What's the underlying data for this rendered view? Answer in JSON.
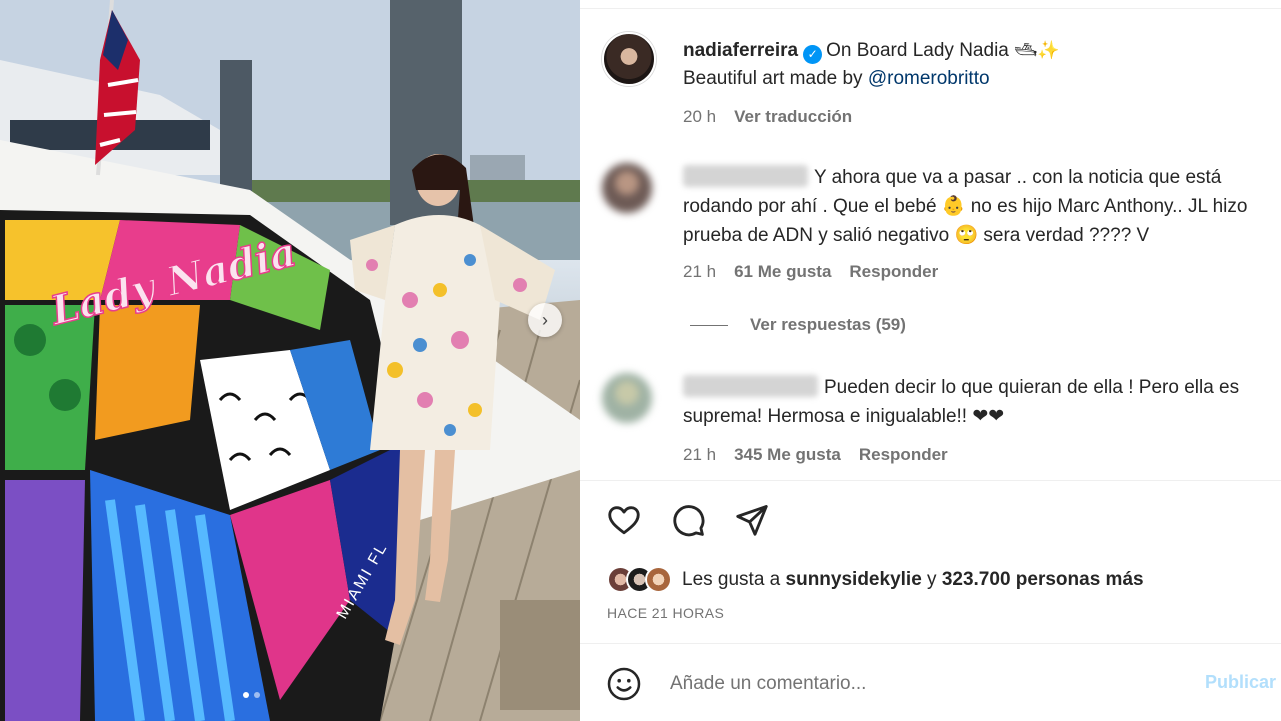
{
  "post": {
    "username": "nadiaferreira",
    "caption_title": "On Board Lady Nadia",
    "caption_emojis": "🛥✨",
    "caption_line2_prefix": "Beautiful art made by",
    "mention": "@romerobritto",
    "time": "20 h",
    "translate_label": "Ver traducción",
    "photo_text": {
      "boat_name": "Lady Nadia",
      "hull_text": "MIAMI FL"
    }
  },
  "comments": [
    {
      "text": "Y ahora que va a pasar .. con la noticia que está rodando por ahí . Que el bebé 👶 no es hijo Marc Anthony.. JL hizo prueba de ADN y salió negativo 🙄 sera verdad ???? V",
      "time": "21 h",
      "likes": "61 Me gusta",
      "reply_label": "Responder"
    },
    {
      "text": "Pueden decir lo que quieran de ella ! Pero ella es suprema! Hermosa e inigualable!! ❤❤",
      "time": "21 h",
      "likes": "345 Me gusta",
      "reply_label": "Responder"
    }
  ],
  "view_replies": "Ver respuestas (59)",
  "likes_summary": {
    "prefix": "Les gusta a",
    "user": "sunnysidekylie",
    "middle": "y",
    "count": "323.700 personas más"
  },
  "posted_ago": "HACE 21 HORAS",
  "comment_box": {
    "placeholder": "Añade un comentario...",
    "publish_label": "Publicar"
  },
  "carousel": {
    "count": 2,
    "active": 0
  },
  "colors": {
    "link": "#00376b",
    "verified": "#0095f6",
    "muted": "#737373",
    "publish": "#b2dffc"
  },
  "icons": [
    "verified-badge-icon",
    "heart-icon",
    "comment-icon",
    "share-icon",
    "emoji-icon",
    "chevron-right-icon"
  ]
}
